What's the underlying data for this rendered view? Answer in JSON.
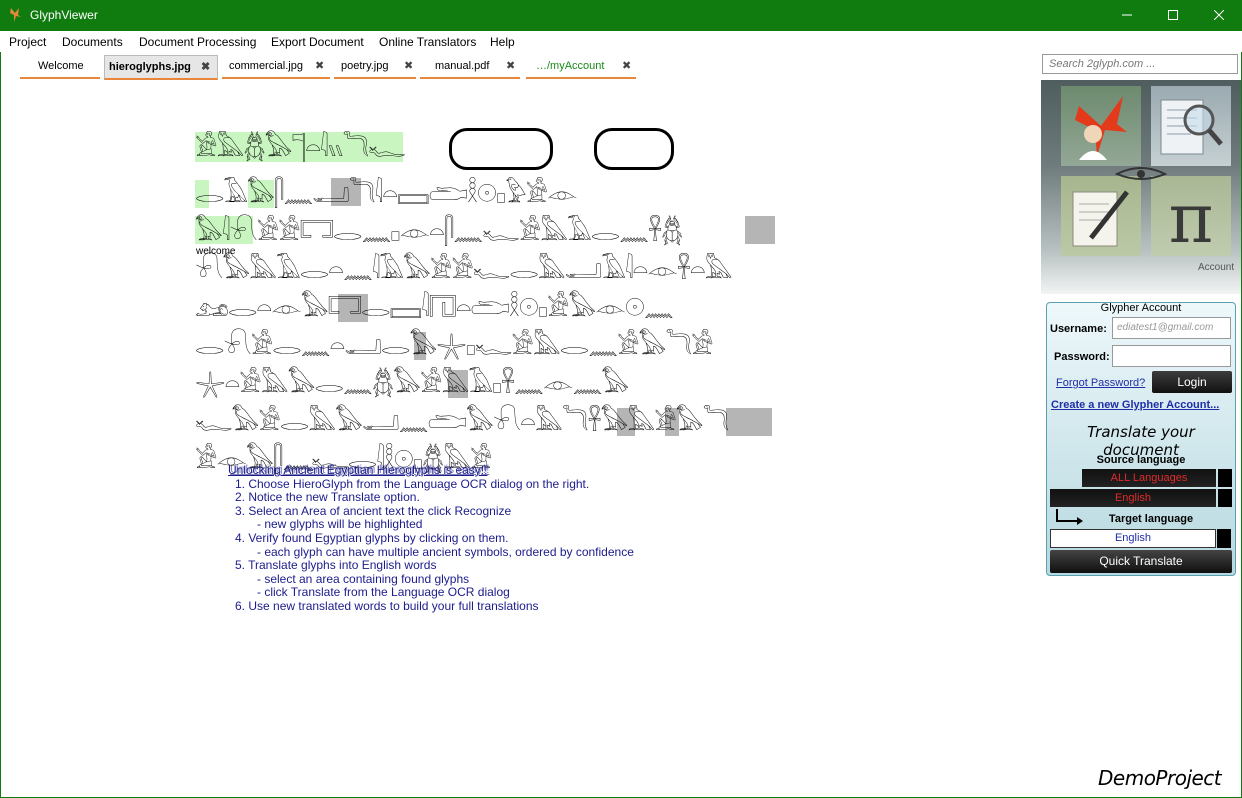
{
  "window": {
    "title": "GlyphViewer"
  },
  "menu": [
    "Project",
    "Documents",
    "Document Processing",
    "Export Document",
    "Online Translators",
    "Help"
  ],
  "tabs": [
    {
      "label": "Welcome",
      "closable": false
    },
    {
      "label": "hieroglyphs.jpg",
      "closable": true,
      "active": true
    },
    {
      "label": "commercial.jpg",
      "closable": true
    },
    {
      "label": "poetry.jpg",
      "closable": true
    },
    {
      "label": "manual.pdf",
      "closable": true
    },
    {
      "label": "…/myAccount",
      "closable": true
    }
  ],
  "search": {
    "placeholder": "Search 2glyph.com ..."
  },
  "image": {
    "caption": "welcome",
    "rows": [
      "𓀀𓅓𓆣𓅃𓊹𓏏𓇋𓏭𓆓𓆑",
      "𓂋𓄿𓅃𓋴𓈖𓂝𓆓𓇋𓏏𓈙𓂧𓎛𓇳𓊪𓅱𓀀𓁹",
      "𓅃𓇋𓍯𓀀𓀀𓉐𓂋𓈖𓊪𓁹𓏏𓋴𓈖𓆑𓀀𓅓𓄿𓂋𓈖𓋹𓆣",
      "𓍯𓅃𓅓𓄿𓂋𓏏𓈖𓇋𓄿𓅃𓀀𓀀𓆑𓂋𓅓𓂝𓄿𓇋𓏏𓁹𓋹𓏏𓅓",
      "𓃭𓂋𓏏𓁹𓅃𓉐𓂋𓈙𓇋𓉔𓏏𓂧𓎛𓇳𓊪𓀀𓅃𓁹𓇳𓈖",
      "𓂋𓍯𓀀𓂋𓈖𓏏𓂝𓂋𓅃𓇼𓊪𓆑𓀀𓅓𓂋𓈖𓀀𓅃𓆓𓀀",
      "𓇼𓏏𓀀𓅓𓅃𓂋𓈖𓆣𓅃𓀀𓅓𓄿𓊪𓋹𓈖𓁹𓈖𓅃",
      "𓆑𓅃𓀀𓂋𓅓𓅃𓂝𓈖𓂧𓅃𓍯𓏏𓅓𓆓𓋹𓅃𓅓𓀀𓅃𓆓",
      "𓀀𓁹𓅃𓋴𓈖𓆑𓂋𓇋𓎛𓇳𓊪𓆣𓅓𓀀"
    ]
  },
  "instructions": {
    "heading": "Unlocking Ancient Egyptian Hieroglyphs is easy!!",
    "heading_overlay": "Unlocking Ancient Egyptian Hieroglyphs is easy!!",
    "lines": [
      {
        "text": "1. Choose HieroGlyph from the Language OCR dialog on the right.",
        "level": 1
      },
      {
        "text": "2. Notice the new Translate option.",
        "level": 1
      },
      {
        "text": "3. Select an Area of ancient text the click Recognize",
        "level": 1
      },
      {
        "text": "- new glyphs will be highlighted",
        "level": 2
      },
      {
        "text": "4. Verify found Egyptian glyphs by clicking on them.",
        "level": 1
      },
      {
        "text": "- each glyph can have multiple ancient symbols, ordered by confidence",
        "level": 2
      },
      {
        "text": "5. Translate glyphs into English words",
        "level": 1
      },
      {
        "text": "- select an area containing found glyphs",
        "level": 2
      },
      {
        "text": "- click Translate from the Language OCR dialog",
        "level": 2
      },
      {
        "text": "6. Use new translated words to build your full translations",
        "level": 1
      }
    ]
  },
  "footer": {
    "project": "DemoProject"
  },
  "side_panel": {
    "account_label": "Account",
    "tiles": [
      "logo-tile",
      "search-document-tile",
      "edit-document-tile",
      "pi-tile"
    ]
  },
  "login": {
    "heading": "Glypher Account",
    "username_label": "Username:",
    "username_value": "ediatest1@gmail.com",
    "password_label": "Password:",
    "password_value": "",
    "forgot_label": "Forgot Password?",
    "login_label": "Login",
    "create_label": "Create a new Glypher Account...",
    "slogan": "Translate your document",
    "source_label": "Source language",
    "source_options": [
      "ALL Languages",
      "English"
    ],
    "target_label": "Target language",
    "target_value": "English",
    "quick_label": "Quick Translate"
  },
  "colors": {
    "titlebar": "#107c10",
    "tab_underline": "#e8863c",
    "link": "#1f2ea8",
    "instructions": "#1c1c8c"
  }
}
